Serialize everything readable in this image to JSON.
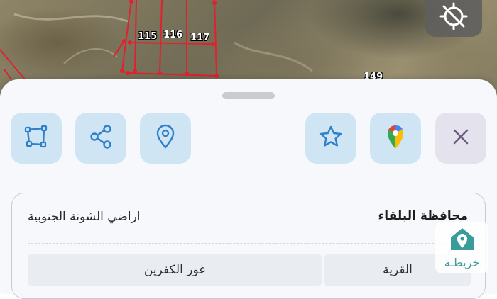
{
  "map": {
    "parcels": [
      "115",
      "116",
      "117",
      "149"
    ]
  },
  "compass_icon": "location-disabled-icon",
  "actions": [
    {
      "name": "draw-polygon-button",
      "icon": "polygon-icon"
    },
    {
      "name": "share-button",
      "icon": "share-icon"
    },
    {
      "name": "location-button",
      "icon": "location-pin-icon"
    },
    {
      "name": "favorite-button",
      "icon": "star-icon"
    },
    {
      "name": "google-maps-button",
      "icon": "google-maps-icon"
    },
    {
      "name": "close-button",
      "icon": "close-icon"
    }
  ],
  "details": {
    "governorate_title": "محافظة البلقاء",
    "lands_name": "اراضي الشونة الجنوبية",
    "village_label": "القرية",
    "village_value": "غور الكفرين"
  },
  "watermark": {
    "text": "خريطـة"
  },
  "colors": {
    "accent": "#2f80c8",
    "action_bg": "#cfe5f4",
    "parcel_border": "#e0212e",
    "teal": "#3a9c9a"
  }
}
